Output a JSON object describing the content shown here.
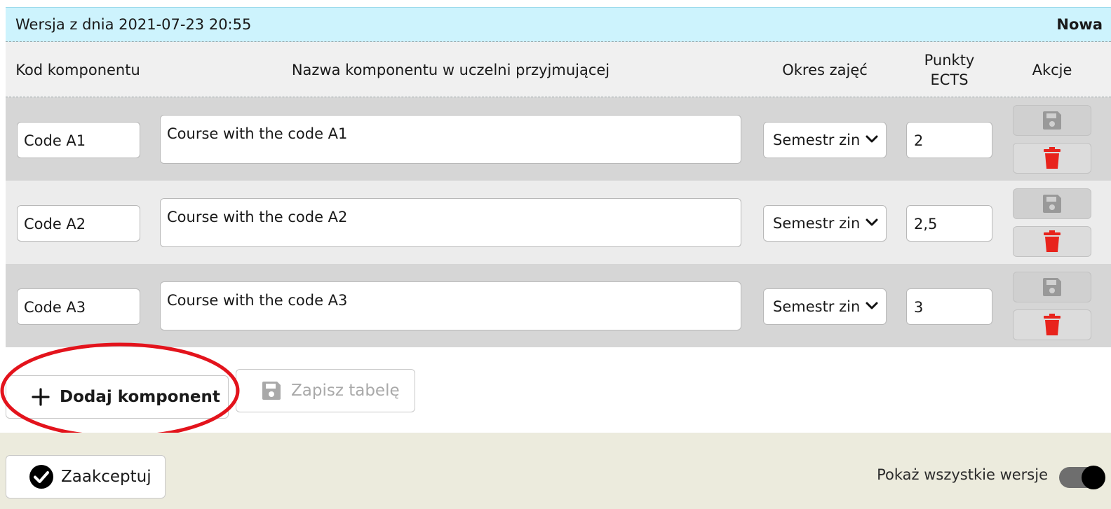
{
  "version_bar": {
    "title": "Wersja z dnia 2021-07-23 20:55",
    "status": "Nowa"
  },
  "table": {
    "headers": {
      "code": "Kod komponentu",
      "name": "Nazwa komponentu w uczelni przyjmującej",
      "period": "Okres zajęć",
      "ects_line1": "Punkty",
      "ects_line2": "ECTS",
      "actions": "Akcje"
    },
    "rows": [
      {
        "code": "Code A1",
        "name": "Course with the code A1",
        "period": "Semestr zin",
        "ects": "2"
      },
      {
        "code": "Code A2",
        "name": "Course with the code A2",
        "period": "Semestr zin",
        "ects": "2,5"
      },
      {
        "code": "Code A3",
        "name": "Course with the code A3",
        "period": "Semestr zin",
        "ects": "3"
      }
    ]
  },
  "buttons": {
    "add_component": "Dodaj komponent",
    "save_table": "Zapisz tabelę",
    "accept": "Zaakceptuj"
  },
  "toggle": {
    "label": "Pokaż wszystkie wersje",
    "on": true
  },
  "colors": {
    "version_bar_bg": "#cdf3fd",
    "delete_icon": "#e8231c",
    "annotation_circle": "#e3131c",
    "footer_bg": "#ecebdd"
  },
  "icons": [
    "save-icon",
    "trash-icon",
    "plus-icon",
    "check-circle-icon",
    "chevron-down-icon"
  ]
}
